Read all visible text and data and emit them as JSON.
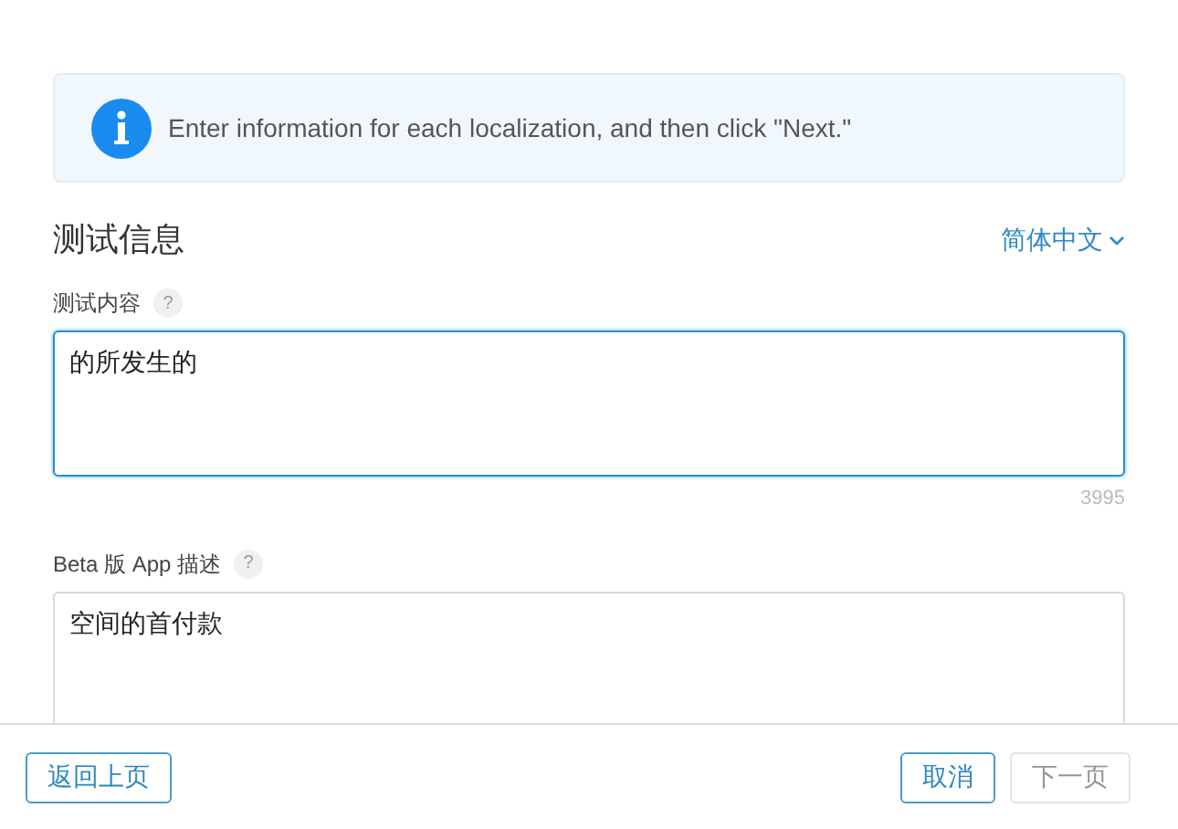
{
  "notice": {
    "text": "Enter information for each localization, and then click \"Next.\""
  },
  "section": {
    "title": "测试信息",
    "language": "简体中文"
  },
  "fields": [
    {
      "label": "测试内容",
      "help": "?",
      "value": "的所发生的",
      "focused": true,
      "counter": "3995"
    },
    {
      "label": "Beta 版 App 描述",
      "help": "?",
      "value": "空间的首付款",
      "focused": false
    }
  ],
  "footer": {
    "back": {
      "label": "返回上页",
      "disabled": false
    },
    "buttons": [
      {
        "label": "取消",
        "disabled": false
      },
      {
        "label": "下一页",
        "disabled": true
      }
    ]
  }
}
